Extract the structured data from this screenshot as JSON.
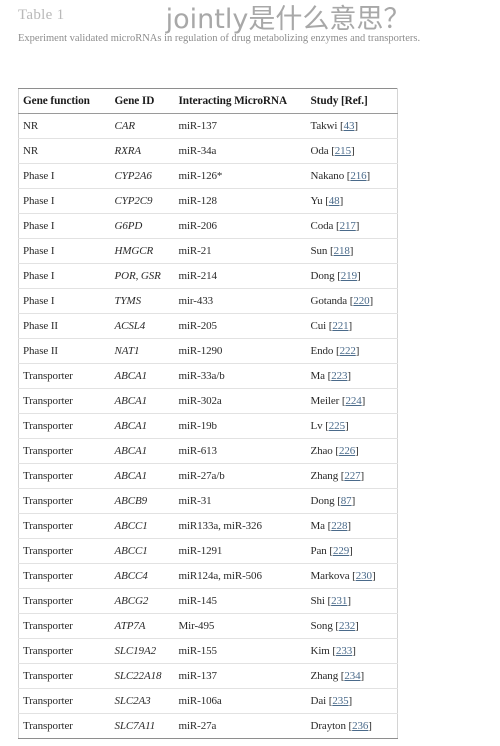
{
  "caption": {
    "label": "Table 1",
    "text": "Experiment validated microRNAs in regulation of drug metabolizing enzymes and transporters."
  },
  "overlay": {
    "text": "jointly是什么意思？",
    "color": "#a8a8a8"
  },
  "colors": {
    "link": "#4a6a8a",
    "caption_label": "#b9b9b9",
    "caption_text": "#8d8d8d",
    "table_border": "#8e8e8e",
    "row_border": "#e2e2e2"
  },
  "table": {
    "columns": [
      "Gene function",
      "Gene ID",
      "Interacting MicroRNA",
      "Study [Ref.]"
    ],
    "rows": [
      {
        "gene_function": "NR",
        "gene_id": "CAR",
        "microrna": "miR-137",
        "study_author": "Takwi",
        "study_ref": "43"
      },
      {
        "gene_function": "NR",
        "gene_id": "RXRA",
        "microrna": "miR-34a",
        "study_author": "Oda",
        "study_ref": "215"
      },
      {
        "gene_function": "Phase I",
        "gene_id": "CYP2A6",
        "microrna": "miR-126*",
        "study_author": "Nakano",
        "study_ref": "216"
      },
      {
        "gene_function": "Phase I",
        "gene_id": "CYP2C9",
        "microrna": "miR-128",
        "study_author": "Yu",
        "study_ref": "48"
      },
      {
        "gene_function": "Phase I",
        "gene_id": "G6PD",
        "microrna": "miR-206",
        "study_author": "Coda",
        "study_ref": "217"
      },
      {
        "gene_function": "Phase I",
        "gene_id": "HMGCR",
        "microrna": "miR-21",
        "study_author": "Sun",
        "study_ref": "218"
      },
      {
        "gene_function": "Phase I",
        "gene_id": "POR, GSR",
        "microrna": "miR-214",
        "study_author": "Dong",
        "study_ref": "219"
      },
      {
        "gene_function": "Phase I",
        "gene_id": "TYMS",
        "microrna": "mir-433",
        "study_author": "Gotanda",
        "study_ref": "220"
      },
      {
        "gene_function": "Phase II",
        "gene_id": "ACSL4",
        "microrna": "miR-205",
        "study_author": "Cui",
        "study_ref": "221"
      },
      {
        "gene_function": "Phase II",
        "gene_id": "NAT1",
        "microrna": "miR-1290",
        "study_author": "Endo",
        "study_ref": "222"
      },
      {
        "gene_function": "Transporter",
        "gene_id": "ABCA1",
        "microrna": "miR-33a/b",
        "study_author": "Ma",
        "study_ref": "223"
      },
      {
        "gene_function": "Transporter",
        "gene_id": "ABCA1",
        "microrna": "miR-302a",
        "study_author": "Meiler",
        "study_ref": "224"
      },
      {
        "gene_function": "Transporter",
        "gene_id": "ABCA1",
        "microrna": "miR-19b",
        "study_author": "Lv",
        "study_ref": "225"
      },
      {
        "gene_function": "Transporter",
        "gene_id": "ABCA1",
        "microrna": "miR-613",
        "study_author": "Zhao",
        "study_ref": "226"
      },
      {
        "gene_function": "Transporter",
        "gene_id": "ABCA1",
        "microrna": "miR-27a/b",
        "study_author": "Zhang",
        "study_ref": "227"
      },
      {
        "gene_function": "Transporter",
        "gene_id": "ABCB9",
        "microrna": "miR-31",
        "study_author": "Dong",
        "study_ref": "87"
      },
      {
        "gene_function": "Transporter",
        "gene_id": "ABCC1",
        "microrna": "miR133a, miR-326",
        "study_author": "Ma",
        "study_ref": "228"
      },
      {
        "gene_function": "Transporter",
        "gene_id": "ABCC1",
        "microrna": "miR-1291",
        "study_author": "Pan",
        "study_ref": "229"
      },
      {
        "gene_function": "Transporter",
        "gene_id": "ABCC4",
        "microrna": "miR124a, miR-506",
        "study_author": "Markova",
        "study_ref": "230"
      },
      {
        "gene_function": "Transporter",
        "gene_id": "ABCG2",
        "microrna": "miR-145",
        "study_author": "Shi",
        "study_ref": "231"
      },
      {
        "gene_function": "Transporter",
        "gene_id": "ATP7A",
        "microrna": "Mir-495",
        "study_author": "Song",
        "study_ref": "232"
      },
      {
        "gene_function": "Transporter",
        "gene_id": "SLC19A2",
        "microrna": "miR-155",
        "study_author": "Kim",
        "study_ref": "233"
      },
      {
        "gene_function": "Transporter",
        "gene_id": "SLC22A18",
        "microrna": "miR-137",
        "study_author": "Zhang",
        "study_ref": "234"
      },
      {
        "gene_function": "Transporter",
        "gene_id": "SLC2A3",
        "microrna": "miR-106a",
        "study_author": "Dai",
        "study_ref": "235"
      },
      {
        "gene_function": "Transporter",
        "gene_id": "SLC7A11",
        "microrna": "miR-27a",
        "study_author": "Drayton",
        "study_ref": "236"
      }
    ]
  }
}
